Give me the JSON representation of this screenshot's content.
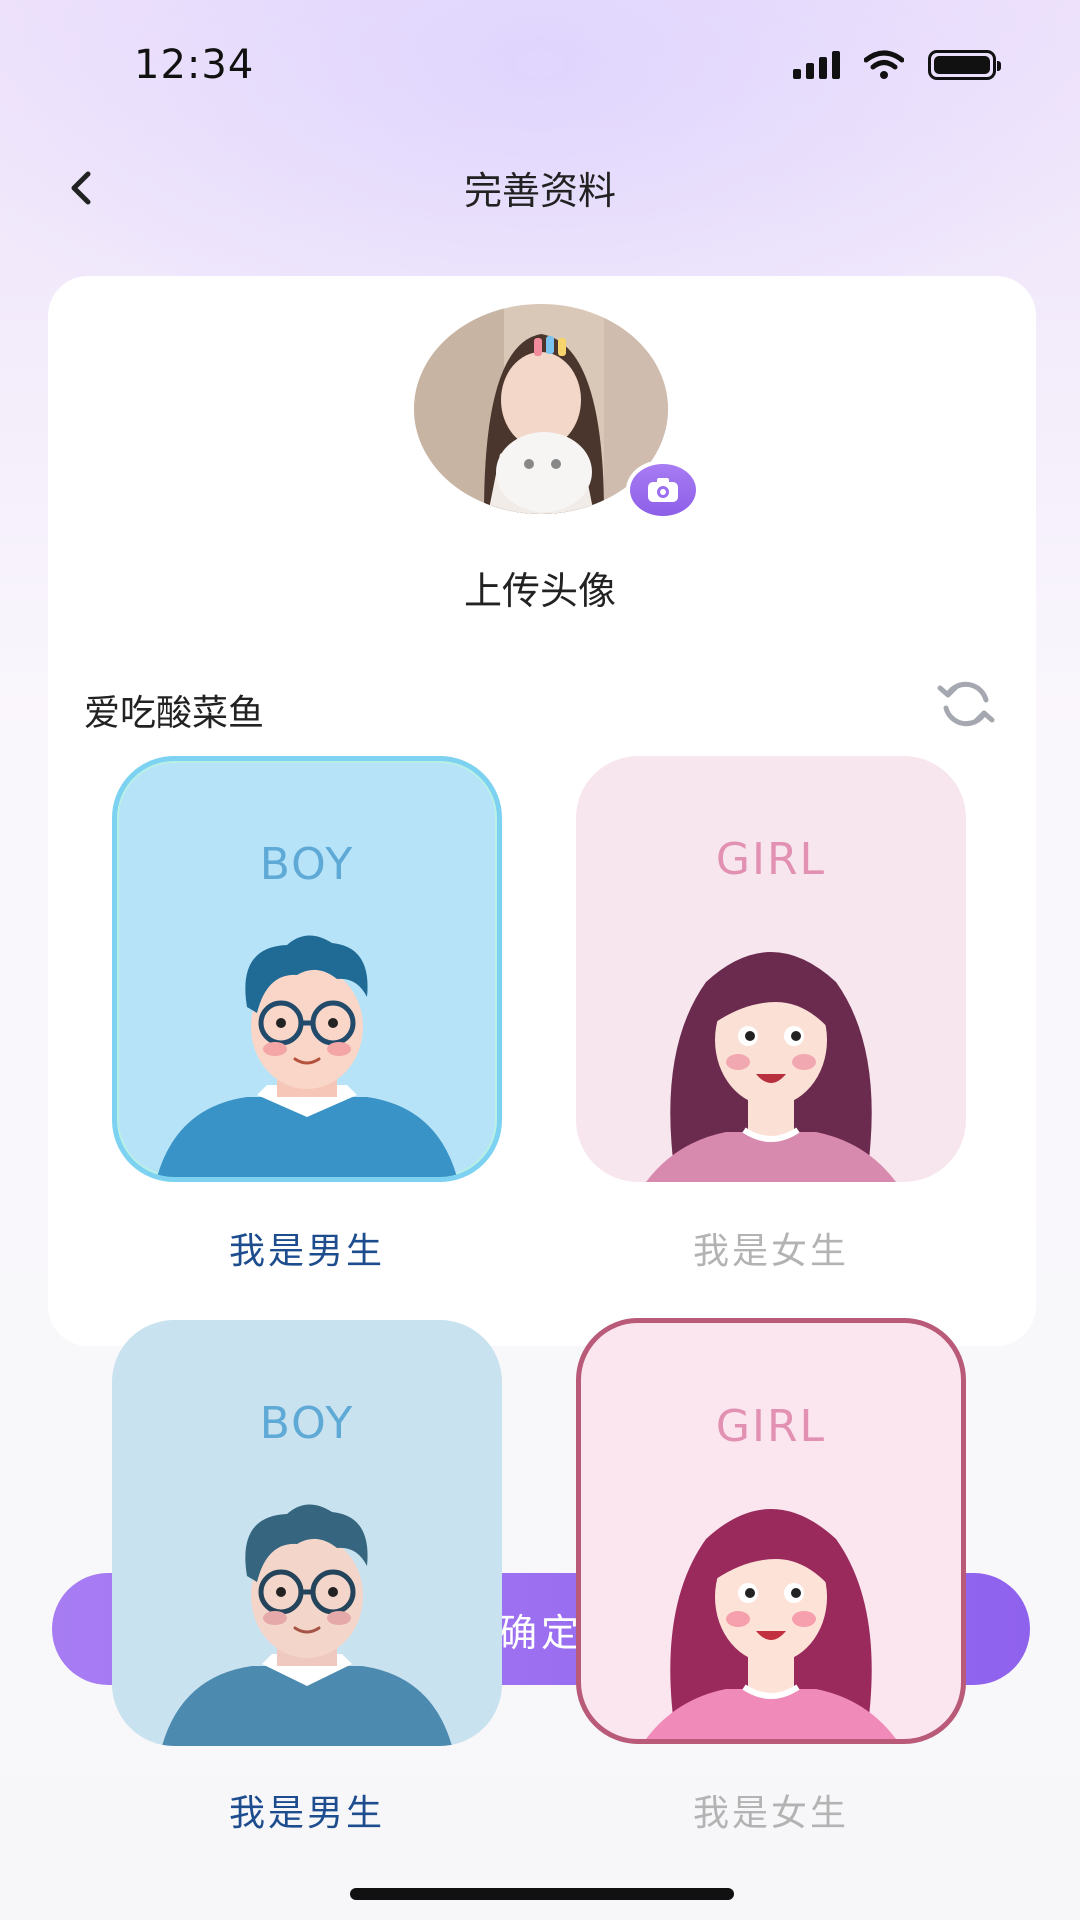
{
  "status_bar": {
    "time": "12:34"
  },
  "header": {
    "title": "完善资料",
    "back_icon": "chevron-left-icon"
  },
  "profile": {
    "upload_label": "上传头像",
    "nickname": "爱吃酸菜鱼"
  },
  "gender_options": {
    "boy_tag": "BOY",
    "girl_tag": "GIRL",
    "boy_label": "我是男生",
    "girl_label": "我是女生"
  },
  "confirm_button": {
    "label": "确定"
  },
  "colors": {
    "accent": "#9b6ef0",
    "boy_active_label": "#1d4d8e",
    "inactive_label": "#b3b3b3",
    "boy_tile": "#b6e3f8",
    "girl_tile": "#f7e6ee"
  }
}
